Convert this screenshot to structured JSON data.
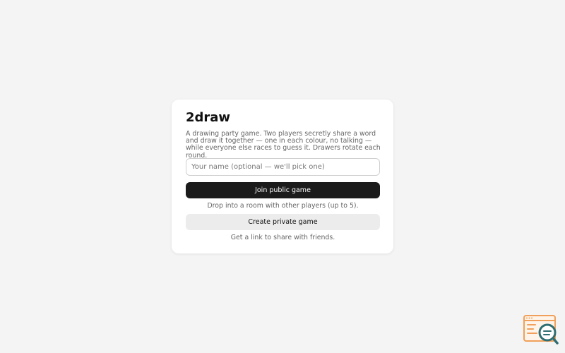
{
  "app": {
    "title": "2draw",
    "description": "A drawing party game. Two players secretly share a word and draw it together — one in each colour, no talking — while everyone else races to guess it. Drawers rotate each round."
  },
  "form": {
    "name_placeholder": "Your name (optional — we'll pick one)",
    "name_value": ""
  },
  "actions": {
    "join_public_label": "Join public game",
    "join_public_hint": "Drop into a room with other players (up to 5).",
    "create_private_label": "Create private game",
    "create_private_hint": "Get a link to share with friends."
  },
  "icons": {
    "corner_logo": "browser-search-icon"
  },
  "colors": {
    "background": "#f4f4f4",
    "card": "#ffffff",
    "primary_button": "#1b1b1b",
    "secondary_button": "#ececec",
    "logo_orange": "#f0a05a",
    "logo_teal": "#2f6f73"
  }
}
